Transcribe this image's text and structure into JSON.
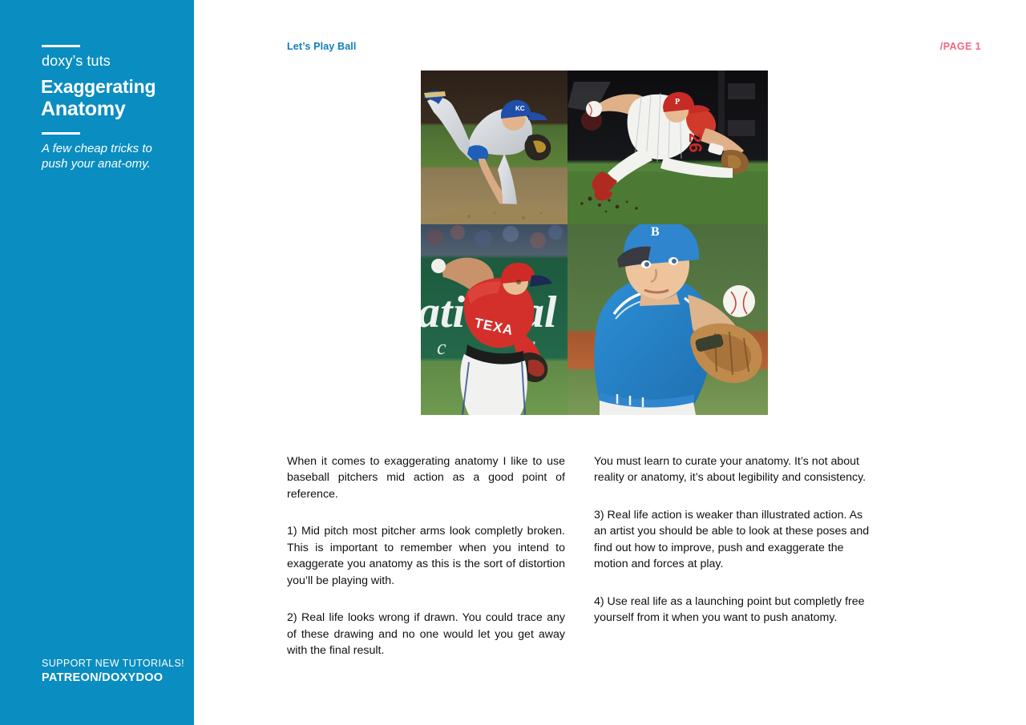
{
  "sidebar": {
    "kicker": "doxy’s tuts",
    "title_line1": "Exaggerating",
    "title_line2": "Anatomy",
    "subtitle": "A few cheap tricks to push your anat-omy.",
    "support_line1": "SUPPORT NEW TUTORIALS!",
    "support_line2": "PATREON/DOXYDOO",
    "background_color": "#0a8dc0",
    "text_color": "#ffffff"
  },
  "header": {
    "title": "Let’s Play Ball",
    "title_color": "#0e7dbd",
    "page_label": "/PAGE 1",
    "page_color": "#f4677f"
  },
  "photo_grid": {
    "cells": [
      {
        "name": "pitcher-kansas-city-royals",
        "caption": "Kansas City Royals pitcher in follow-through, grey away uniform, blue KC cap",
        "team_mark": "KC",
        "jersey_number": ""
      },
      {
        "name": "infielder-philadelphia-phillies",
        "caption": "Philadelphia Phillies infielder diving throw, white pinstripes, red cap",
        "team_mark": "P",
        "jersey_number": "26"
      },
      {
        "name": "pitcher-texas-rangers",
        "caption": "Texas Rangers pitcher winding up, red jersey, white pants",
        "team_mark": "TEXAS",
        "jersey_number": ""
      },
      {
        "name": "pitcher-youth-blue-jersey",
        "caption": "Young pitcher in blue sleeveless jersey and blue cap, ball in hand behind glove",
        "team_mark": "B",
        "jersey_number": ""
      }
    ]
  },
  "body": {
    "left_column": [
      "When it comes to exaggerating anatomy I like to use baseball pitchers mid action as a good point of reference.",
      "1) Mid pitch most pitcher arms look completly broken. This is important to remember when you intend to exaggerate you anatomy as this is the sort of distortion you’ll be playing with.",
      "2) Real life looks wrong if drawn. You could trace any of these drawing and no one would let you get away with the final result."
    ],
    "right_column": [
      "You must learn to curate your anatomy. It’s not about reality or anatomy, it’s about legibility and consistency.",
      "3) Real life action is weaker than illustrated action. As an artist you should be able to look at these poses and find out how to improve, push and exaggerate the motion and forces at play.",
      "4) Use real life as a launching point but completly free yourself from it when you want to push anatomy."
    ]
  }
}
